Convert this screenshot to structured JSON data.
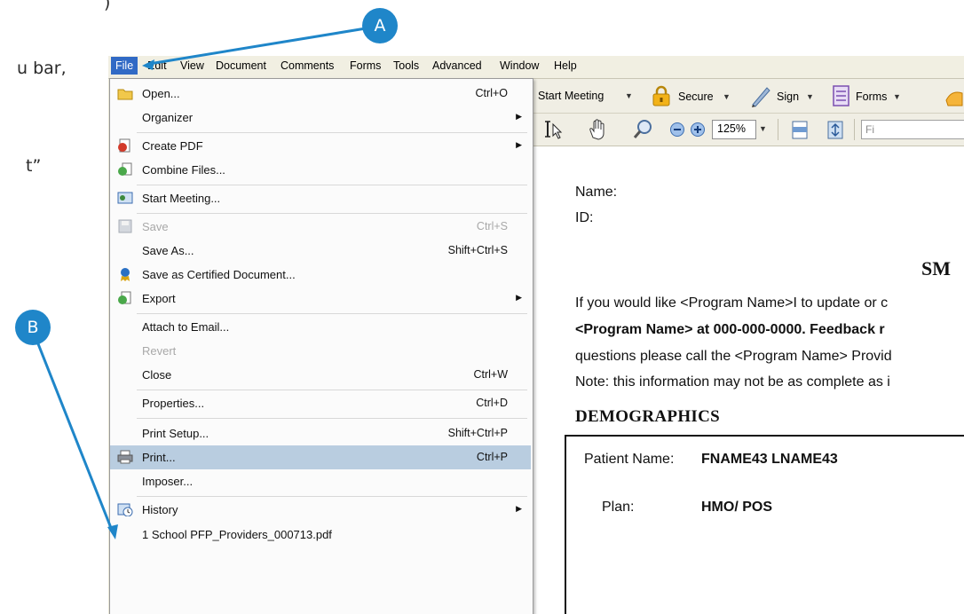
{
  "prose": {
    "frag_top": ")",
    "frag_menu_bar": "u bar,",
    "frag_quote": "t”"
  },
  "callouts": {
    "a": "A",
    "b": "B"
  },
  "menubar": {
    "items": [
      "File",
      "Edit",
      "View",
      "Document",
      "Comments",
      "Forms",
      "Tools",
      "Advanced",
      "Window",
      "Help"
    ]
  },
  "toolbar1": {
    "start_meeting": "Start Meeting",
    "secure": "Secure",
    "sign": "Sign",
    "forms": "Forms"
  },
  "toolbar2": {
    "zoom": "125%",
    "find_placeholder": "Fi"
  },
  "file_menu": {
    "items": [
      {
        "label": "Open...",
        "shortcut": "Ctrl+O",
        "icon": "folder-icon"
      },
      {
        "label": "Organizer",
        "shortcut": ""
      },
      {
        "label": "Create PDF",
        "shortcut": "",
        "icon": "create-pdf-icon"
      },
      {
        "label": "Combine Files...",
        "shortcut": "",
        "icon": "combine-files-icon"
      },
      {
        "label": "Start Meeting...",
        "shortcut": "",
        "icon": "meeting-icon"
      },
      {
        "label": "Save",
        "shortcut": "Ctrl+S",
        "icon": "save-icon",
        "disabled": true
      },
      {
        "label": "Save As...",
        "shortcut": "Shift+Ctrl+S"
      },
      {
        "label": "Save as Certified Document...",
        "shortcut": "",
        "icon": "certified-ribbon-icon"
      },
      {
        "label": "Export",
        "shortcut": "",
        "icon": "export-icon"
      },
      {
        "label": "Attach to Email...",
        "shortcut": ""
      },
      {
        "label": "Revert",
        "shortcut": "",
        "disabled": true
      },
      {
        "label": "Close",
        "shortcut": "Ctrl+W"
      },
      {
        "label": "Properties...",
        "shortcut": "Ctrl+D"
      },
      {
        "label": "Print Setup...",
        "shortcut": "Shift+Ctrl+P"
      },
      {
        "label": "Print...",
        "shortcut": "Ctrl+P",
        "icon": "printer-icon",
        "highlighted": true
      },
      {
        "label": "Imposer...",
        "shortcut": ""
      },
      {
        "label": "History",
        "shortcut": "",
        "icon": "history-icon"
      },
      {
        "label": "1 School PFP_Providers_000713.pdf",
        "shortcut": ""
      }
    ]
  },
  "document": {
    "name_label": "Name:",
    "id_label": "ID:",
    "title_fragment": "SM",
    "para_line1": "If you would like <Program Name>I to update or c",
    "para_line2": "<Program Name> at 000-000-0000.  Feedback r",
    "para_line3": "questions please call the <Program Name> Provid",
    "para_line4": "Note: this information may not be as complete as i",
    "section_heading": "DEMOGRAPHICS",
    "patient_label": "Patient Name:",
    "patient_value": "FNAME43 LNAME43",
    "plan_label": "Plan:",
    "plan_value": "HMO/ POS"
  }
}
